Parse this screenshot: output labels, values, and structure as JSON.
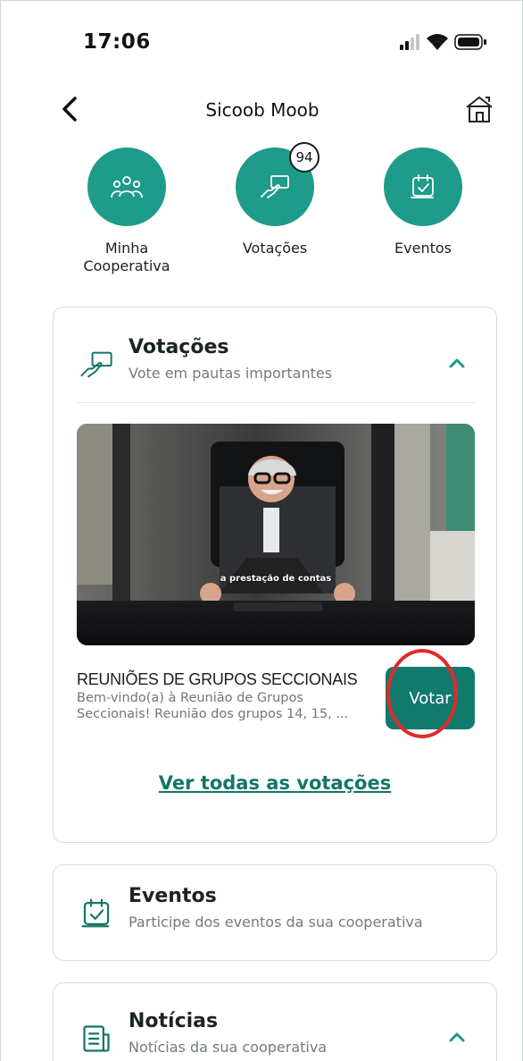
{
  "status_bar": {
    "time": "17:06",
    "icons": [
      "signal-icon",
      "wifi-icon",
      "battery-icon"
    ]
  },
  "header": {
    "title": "Sicoob Moob",
    "back_icon": "chevron-left-icon",
    "home_icon": "home-icon"
  },
  "quick_actions": [
    {
      "label": "Minha Cooperativa",
      "icon": "people-icon"
    },
    {
      "label": "Votações",
      "icon": "vote-hand-icon",
      "badge": "94"
    },
    {
      "label": "Eventos",
      "icon": "calendar-check-icon"
    }
  ],
  "votacoes_card": {
    "title": "Votações",
    "subtitle": "Vote em pautas importantes",
    "icon": "vote-hand-icon",
    "expanded": true,
    "video": {
      "caption": "a prestação de contas"
    },
    "item": {
      "title": "REUNIÕES DE GRUPOS SECCIONAIS",
      "description": "Bem-vindo(a) à Reunião de Grupos Seccionais! Reunião dos grupos 14, 15, ...",
      "button_label": "Votar"
    },
    "see_all": "Ver todas as votações"
  },
  "eventos_card": {
    "title": "Eventos",
    "subtitle": "Participe dos eventos da sua cooperativa",
    "icon": "calendar-check-icon"
  },
  "noticias_card": {
    "title": "Notícias",
    "subtitle": "Notícias da sua cooperativa",
    "icon": "newspaper-icon",
    "expanded": true
  },
  "colors": {
    "accent": "#1e9b8a",
    "button": "#117a6d",
    "link": "#147566",
    "highlight": "#e02a2a"
  }
}
